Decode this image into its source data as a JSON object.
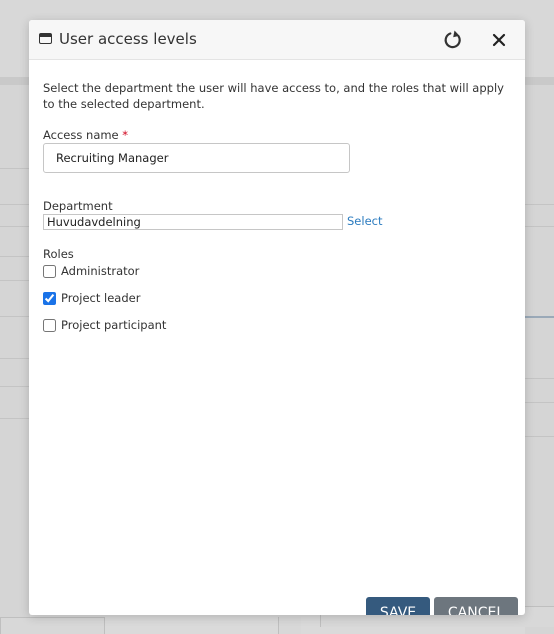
{
  "dialog": {
    "title": "User access levels",
    "icons": {
      "window": "window-icon",
      "refresh": "refresh-icon",
      "close": "close-icon"
    }
  },
  "form": {
    "intro": "Select the department the user will have access to, and the roles that will apply to the selected department.",
    "access_name": {
      "label": "Access name",
      "required_marker": "*",
      "value": "Recruiting Manager"
    },
    "department": {
      "label": "Department",
      "value": "Huvudavdelning",
      "select_link": "Select"
    },
    "roles": {
      "label": "Roles",
      "items": [
        {
          "label": "Administrator",
          "checked": false
        },
        {
          "label": "Project leader",
          "checked": true
        },
        {
          "label": "Project participant",
          "checked": false
        }
      ]
    }
  },
  "buttons": {
    "save": "SAVE",
    "cancel": "CANCEL"
  },
  "colors": {
    "save_button": "#355a7e",
    "cancel_button": "#6d767e",
    "link": "#2b7bbf",
    "required": "#d0021b"
  }
}
